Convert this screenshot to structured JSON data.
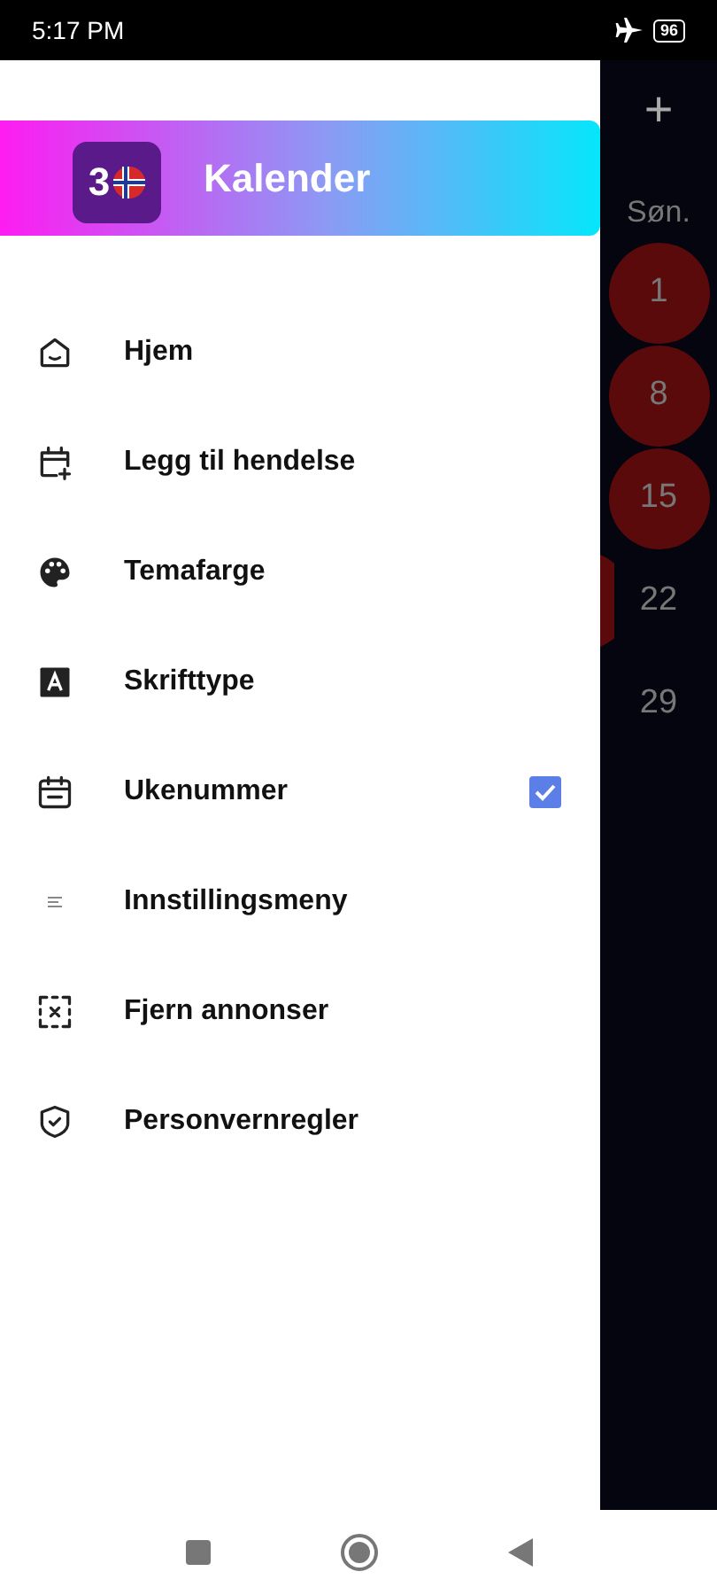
{
  "status_bar": {
    "time": "5:17 PM",
    "battery": "96"
  },
  "drawer": {
    "header": {
      "logo_digit": "3",
      "title": "Kalender"
    },
    "items": [
      {
        "kind": "link",
        "label": "Hjem"
      },
      {
        "kind": "link",
        "label": "Legg til hendelse"
      },
      {
        "kind": "link",
        "label": "Temafarge"
      },
      {
        "kind": "link",
        "label": "Skrifttype"
      },
      {
        "kind": "checkbox",
        "label": "Ukenummer",
        "checked": true
      },
      {
        "kind": "link",
        "label": "Innstillingsmeny"
      },
      {
        "kind": "link",
        "label": "Fjern annonser"
      },
      {
        "kind": "link",
        "label": "Personvernregler"
      }
    ]
  },
  "calendar": {
    "add_button": "+",
    "weekday": "Søn.",
    "days": [
      {
        "label": "1",
        "marked": true
      },
      {
        "label": "8",
        "marked": true
      },
      {
        "label": "15",
        "marked": true
      },
      {
        "label": "22",
        "marked": false
      },
      {
        "label": "29",
        "marked": false
      }
    ]
  }
}
